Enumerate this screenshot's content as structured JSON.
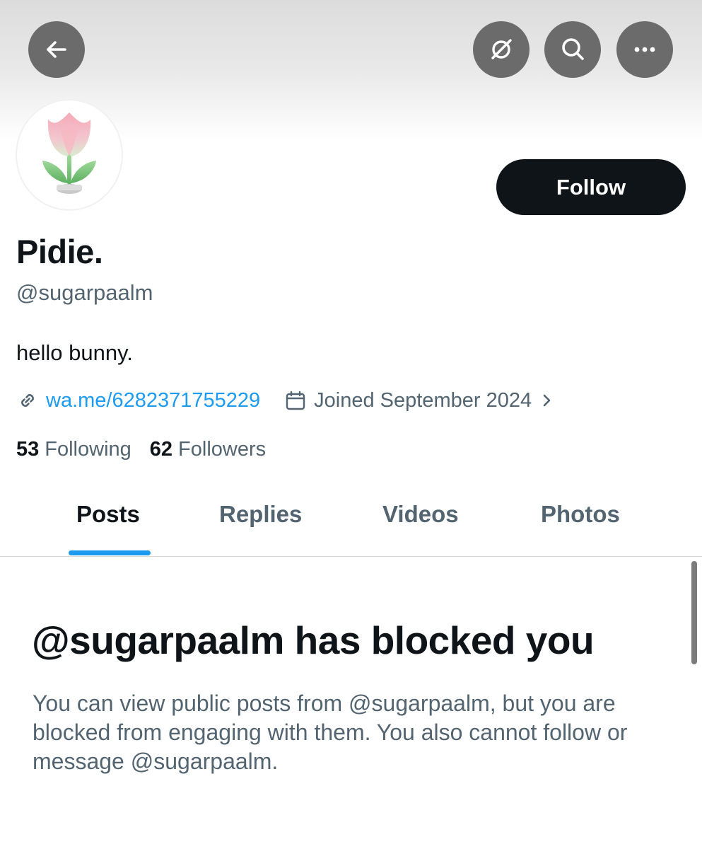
{
  "header": {
    "back_icon": "arrow-left-icon",
    "grok_icon": "grok-icon",
    "search_icon": "search-icon",
    "more_icon": "more-horizontal-icon"
  },
  "profile": {
    "avatar_icon": "tulip-avatar",
    "follow_label": "Follow",
    "display_name": "Pidie.",
    "handle": "@sugarpaalm",
    "bio": "hello bunny.",
    "link": "wa.me/6282371755229",
    "joined": "Joined September 2024",
    "following_count": "53",
    "following_label": "Following",
    "followers_count": "62",
    "followers_label": "Followers"
  },
  "tabs": [
    {
      "label": "Posts",
      "active": true
    },
    {
      "label": "Replies",
      "active": false
    },
    {
      "label": "Videos",
      "active": false
    },
    {
      "label": "Photos",
      "active": false
    }
  ],
  "blocked": {
    "title": "@sugarpaalm has blocked you",
    "description": "You can view public posts from @sugarpaalm, but you are blocked from engaging with them. You also cannot follow or message @sugarpaalm."
  },
  "colors": {
    "accent": "#1d9bf0",
    "text_primary": "#0f1419",
    "text_secondary": "#536471",
    "button_dark": "#0f1419"
  }
}
